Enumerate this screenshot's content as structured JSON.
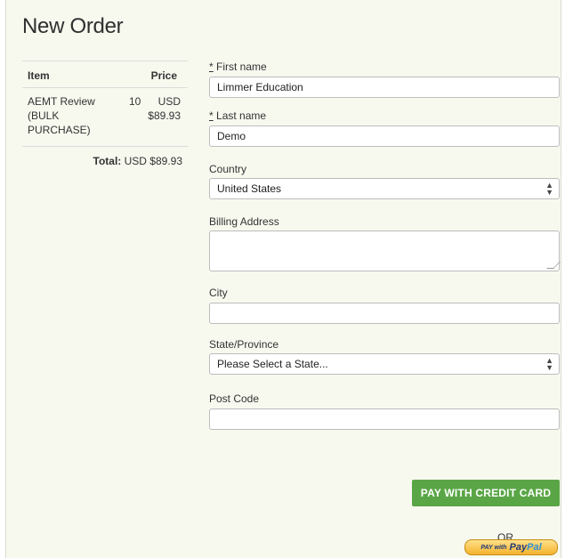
{
  "page": {
    "title": "New Order"
  },
  "cart": {
    "headers": {
      "item": "Item",
      "price": "Price"
    },
    "items": [
      {
        "name": "AEMT Review (BULK PURCHASE)",
        "qty": "10",
        "price_currency": "USD",
        "price_amount": "$89.93"
      }
    ],
    "total_label": "Total:",
    "total_value": "USD $89.93"
  },
  "form": {
    "required_mark": "*",
    "first_name": {
      "label": "First name",
      "value": "Limmer Education"
    },
    "last_name": {
      "label": "Last name",
      "value": "Demo"
    },
    "country": {
      "label": "Country",
      "value": "United States"
    },
    "billing_address": {
      "label": "Billing Address",
      "value": ""
    },
    "city": {
      "label": "City",
      "value": ""
    },
    "state": {
      "label": "State/Province",
      "value": "Please Select a State..."
    },
    "post_code": {
      "label": "Post Code",
      "value": ""
    }
  },
  "actions": {
    "pay_credit_card": "PAY WITH CREDIT CARD",
    "or_label": "OR",
    "paypal_prefix": "PAY with",
    "paypal_brand_a": "Pay",
    "paypal_brand_b": "Pal"
  },
  "colors": {
    "accent_green": "#5aa646",
    "panel_bg": "#f7f9ef"
  }
}
